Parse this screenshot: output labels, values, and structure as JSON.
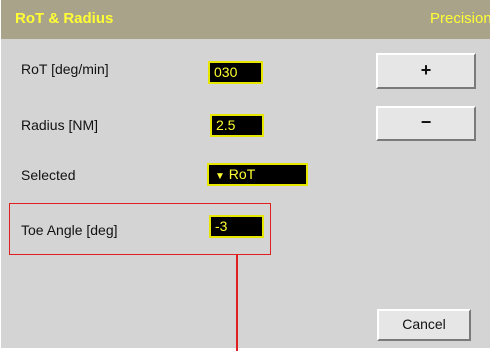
{
  "title": {
    "left": "RoT & Radius",
    "right": "Precision"
  },
  "rows": {
    "rot": {
      "label": "RoT  [deg/min]",
      "value": "030"
    },
    "radius": {
      "label": "Radius [NM]",
      "value": "2.5"
    },
    "selected": {
      "label": "Selected",
      "value": "RoT",
      "arrow": "▼"
    },
    "toe": {
      "label": "Toe Angle [deg]",
      "value": "-3"
    }
  },
  "buttons": {
    "plus": "+",
    "minus": "−",
    "cancel": "Cancel"
  },
  "colors": {
    "title_bar": "#a9a38a",
    "title_text": "#ffff33",
    "panel": "#d4d4d4",
    "field_bg": "#000000",
    "field_text": "#ffff33",
    "highlight": "#e02020"
  }
}
